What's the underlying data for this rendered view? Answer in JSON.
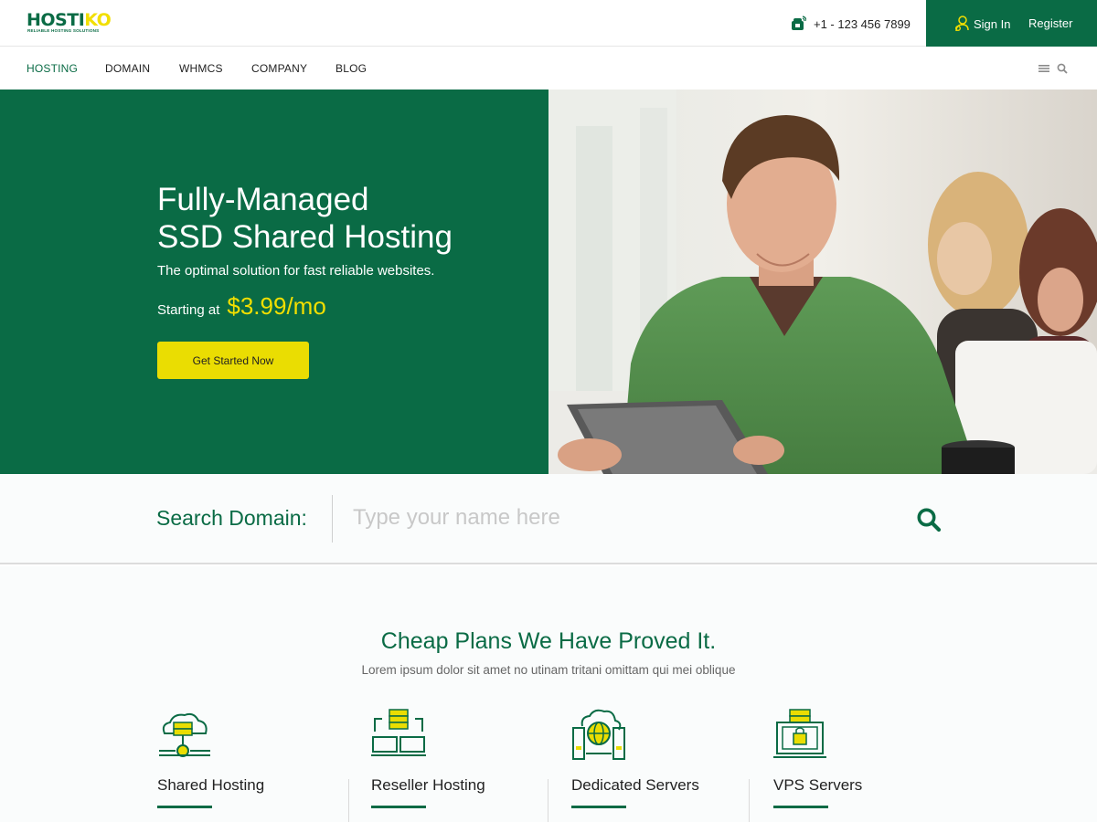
{
  "brand": {
    "name_main": "HOSTI",
    "name_accent": "KO",
    "tagline": "RELIABLE HOSTING SOLUTIONS",
    "primary_color": "#0a6b45",
    "accent_color": "#f2df00"
  },
  "topbar": {
    "phone_icon": "phone-icon",
    "phone": "+1 - 123 456 7899",
    "signin_icon": "user-key-icon",
    "signin_label": "Sign In",
    "register_label": "Register"
  },
  "nav": {
    "items": [
      {
        "label": "HOSTING",
        "active": true
      },
      {
        "label": "DOMAIN",
        "active": false
      },
      {
        "label": "WHMCS",
        "active": false
      },
      {
        "label": "COMPANY",
        "active": false
      },
      {
        "label": "BLOG",
        "active": false
      }
    ],
    "tools": [
      "menu-icon",
      "search-icon"
    ]
  },
  "hero": {
    "title_line1": "Fully-Managed",
    "title_line2": "SSD Shared Hosting",
    "subtitle": "The optimal solution for fast reliable websites.",
    "price_label": "Starting at",
    "price": "$3.99/mo",
    "cta_label": "Get Started Now",
    "image": "man-with-tablet-photo"
  },
  "domain_search": {
    "label": "Search Domain:",
    "placeholder": "Type your name here",
    "value": "",
    "button_icon": "search-icon"
  },
  "plans": {
    "title": "Cheap Plans We Have Proved It.",
    "subtitle": "Lorem ipsum dolor sit amet no utinam tritani omittam qui mei oblique",
    "items": [
      {
        "name": "Shared Hosting",
        "icon": "cloud-server-icon"
      },
      {
        "name": "Reseller Hosting",
        "icon": "server-network-icon"
      },
      {
        "name": "Dedicated Servers",
        "icon": "globe-server-icon"
      },
      {
        "name": "VPS Servers",
        "icon": "secure-server-icon"
      }
    ]
  }
}
